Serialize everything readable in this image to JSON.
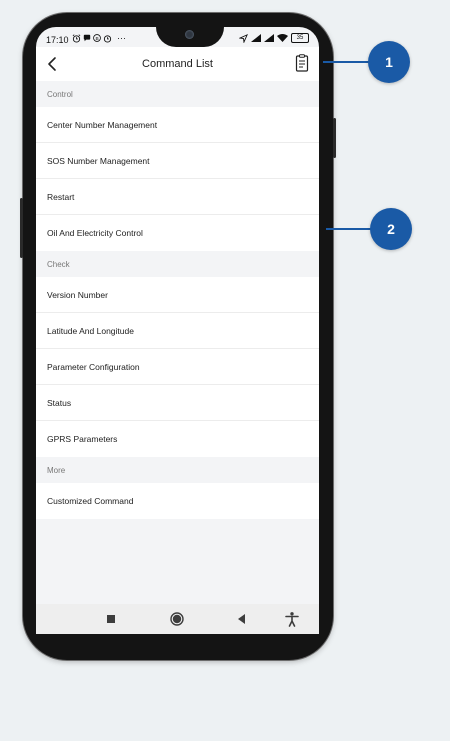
{
  "status_bar": {
    "time": "17:10",
    "more": "···",
    "battery": "35"
  },
  "header": {
    "title": "Command List"
  },
  "sections": [
    {
      "title": "Control",
      "items": [
        "Center Number Management",
        "SOS Number Management",
        "Restart",
        "Oil And Electricity Control"
      ]
    },
    {
      "title": "Check",
      "items": [
        "Version Number",
        "Latitude And Longitude",
        "Parameter Configuration",
        "Status",
        "GPRS Parameters"
      ]
    },
    {
      "title": "More",
      "items": [
        "Customized Command"
      ]
    }
  ],
  "callouts": [
    {
      "label": "1"
    },
    {
      "label": "2"
    }
  ],
  "icons": {
    "back": "back-arrow-icon",
    "list": "document-list-icon",
    "nav": [
      "square-icon",
      "home-circle-icon",
      "back-triangle-icon",
      "accessibility-icon"
    ]
  },
  "colors": {
    "callout": "#1a5aa6",
    "background": "#edf1f3"
  }
}
